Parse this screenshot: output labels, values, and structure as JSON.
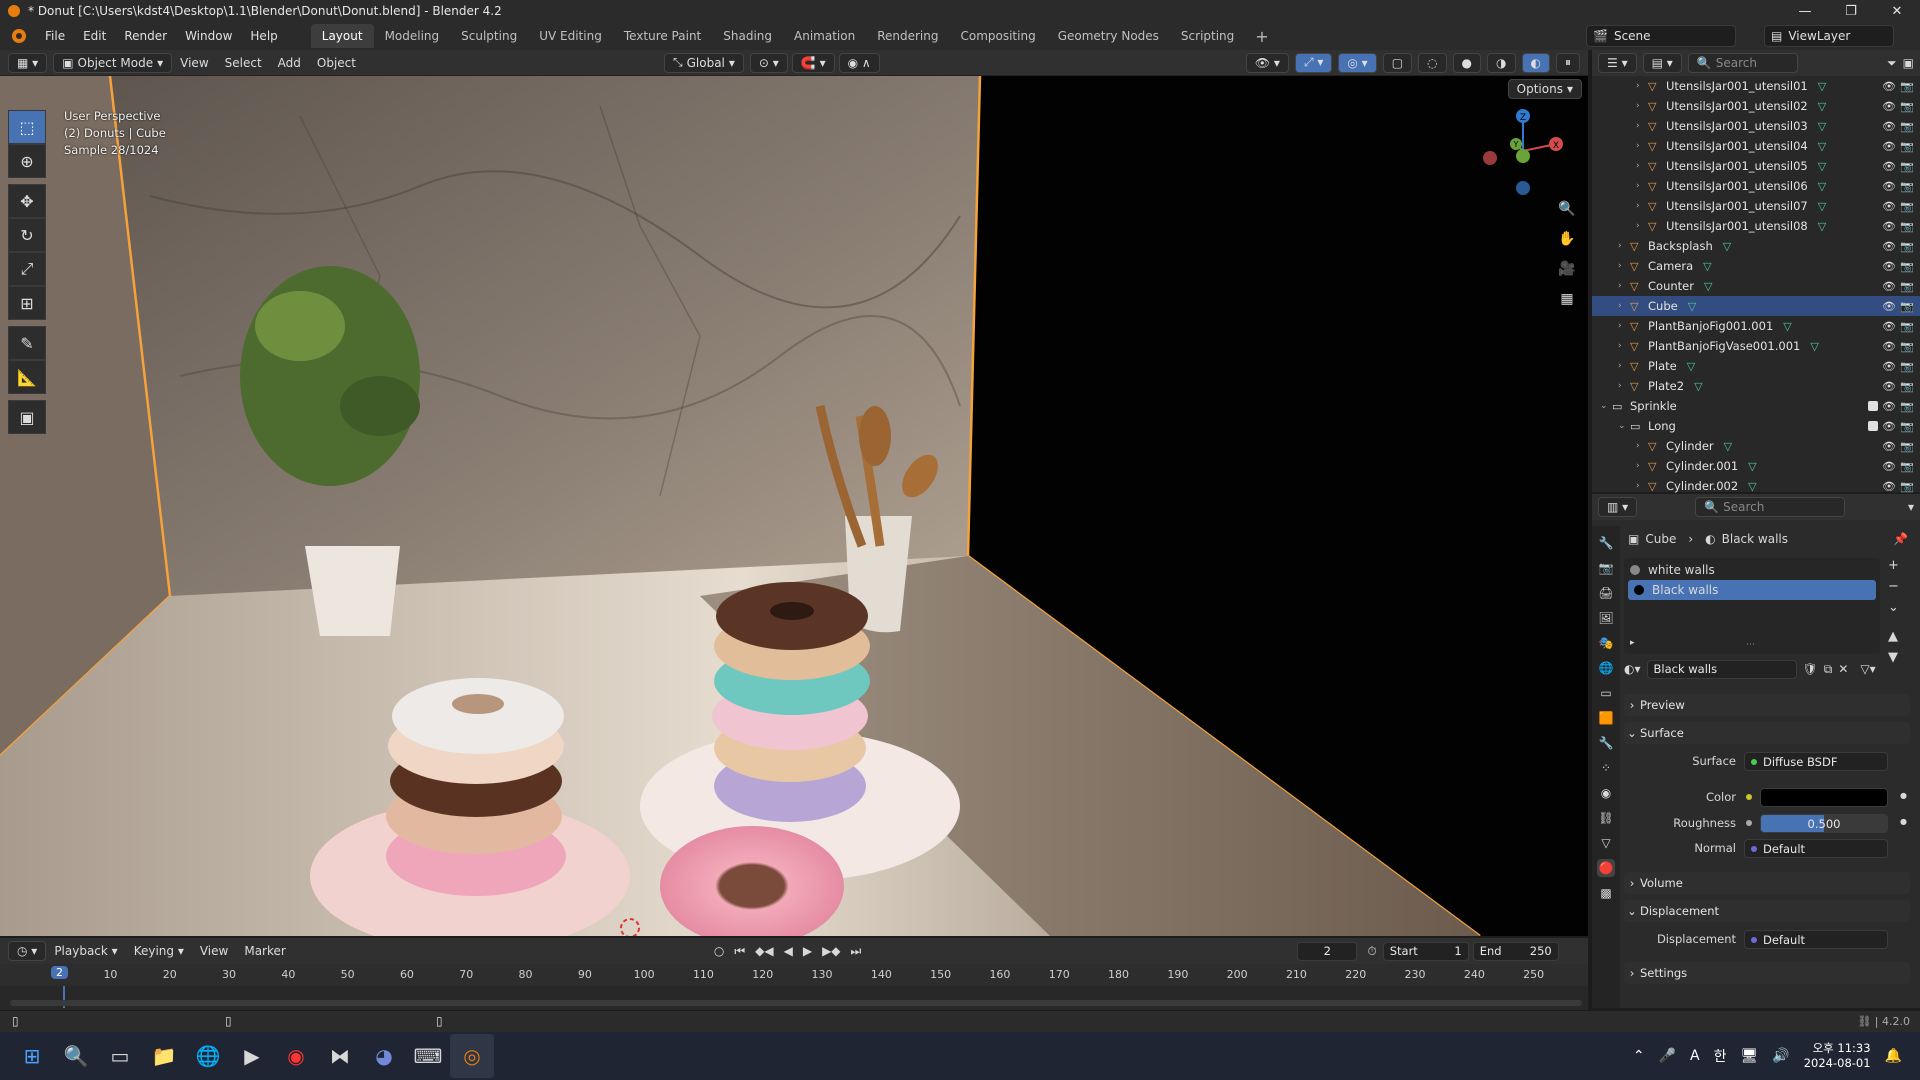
{
  "window": {
    "title": "* Donut [C:\\Users\\kdst4\\Desktop\\1.1\\Blender\\Donut\\Donut.blend] - Blender 4.2",
    "minimize": "—",
    "maximize": "❐",
    "close": "✕"
  },
  "menu": [
    "File",
    "Edit",
    "Render",
    "Window",
    "Help"
  ],
  "workspaces": [
    "Layout",
    "Modeling",
    "Sculpting",
    "UV Editing",
    "Texture Paint",
    "Shading",
    "Animation",
    "Rendering",
    "Compositing",
    "Geometry Nodes",
    "Scripting"
  ],
  "active_workspace": "Layout",
  "scene": {
    "name": "Scene",
    "view_layer": "ViewLayer"
  },
  "viewport": {
    "mode": "Object Mode",
    "header_menus": [
      "View",
      "Select",
      "Add",
      "Object"
    ],
    "transform_orientation": "Global",
    "options_label": "Options",
    "info_lines": [
      "User Perspective",
      "(2) Donuts | Cube",
      "Sample 28/1024"
    ],
    "gizmo": {
      "z": "Z",
      "y": "Y",
      "x": "X"
    }
  },
  "outliner": {
    "search_placeholder": "Search",
    "rows": [
      {
        "name": "UtensilsJar001_utensil01",
        "indent": 2,
        "selected": false
      },
      {
        "name": "UtensilsJar001_utensil02",
        "indent": 2,
        "selected": false
      },
      {
        "name": "UtensilsJar001_utensil03",
        "indent": 2,
        "selected": false
      },
      {
        "name": "UtensilsJar001_utensil04",
        "indent": 2,
        "selected": false
      },
      {
        "name": "UtensilsJar001_utensil05",
        "indent": 2,
        "selected": false
      },
      {
        "name": "UtensilsJar001_utensil06",
        "indent": 2,
        "selected": false
      },
      {
        "name": "UtensilsJar001_utensil07",
        "indent": 2,
        "selected": false
      },
      {
        "name": "UtensilsJar001_utensil08",
        "indent": 2,
        "selected": false
      },
      {
        "name": "Backsplash",
        "indent": 1,
        "selected": false
      },
      {
        "name": "Camera",
        "indent": 1,
        "selected": false
      },
      {
        "name": "Counter",
        "indent": 1,
        "selected": false
      },
      {
        "name": "Cube",
        "indent": 1,
        "selected": true
      },
      {
        "name": "PlantBanjoFig001.001",
        "indent": 1,
        "selected": false
      },
      {
        "name": "PlantBanjoFigVase001.001",
        "indent": 1,
        "selected": false
      },
      {
        "name": "Plate",
        "indent": 1,
        "selected": false
      },
      {
        "name": "Plate2",
        "indent": 1,
        "selected": false
      },
      {
        "name": "Sprinkle",
        "indent": 0,
        "selected": false
      },
      {
        "name": "Long",
        "indent": 1,
        "selected": false
      },
      {
        "name": "Cylinder",
        "indent": 2,
        "selected": false
      },
      {
        "name": "Cylinder.001",
        "indent": 2,
        "selected": false
      },
      {
        "name": "Cylinder.002",
        "indent": 2,
        "selected": false
      }
    ]
  },
  "properties": {
    "search_placeholder": "Search",
    "breadcrumb_object": "Cube",
    "breadcrumb_material": "Black walls",
    "slots": [
      "white walls",
      "Black walls"
    ],
    "material_name": "Black walls",
    "panels": {
      "preview": "Preview",
      "surface": "Surface",
      "volume": "Volume",
      "displacement": "Displacement",
      "settings": "Settings"
    },
    "surface_label": "Surface",
    "surface_value": "Diffuse BSDF",
    "color_label": "Color",
    "color_value": "#000000",
    "roughness_label": "Roughness",
    "roughness_value": "0.500",
    "normal_label": "Normal",
    "normal_value": "Default",
    "displacement_label": "Displacement",
    "displacement_value": "Default"
  },
  "timeline": {
    "menus": [
      "Playback",
      "Keying",
      "View",
      "Marker"
    ],
    "current_frame": "2",
    "start_label": "Start",
    "start_value": "1",
    "end_label": "End",
    "end_value": "250",
    "ticks": [
      "10",
      "20",
      "30",
      "40",
      "50",
      "60",
      "70",
      "80",
      "90",
      "100",
      "110",
      "120",
      "130",
      "140",
      "150",
      "160",
      "170",
      "180",
      "190",
      "200",
      "210",
      "220",
      "230",
      "240",
      "250"
    ],
    "playhead": "2"
  },
  "statusbar": {
    "version": "4.2.0"
  },
  "taskbar": {
    "time": "오후 11:33",
    "date": "2024-08-01",
    "ime": "A",
    "ime2": "한"
  }
}
